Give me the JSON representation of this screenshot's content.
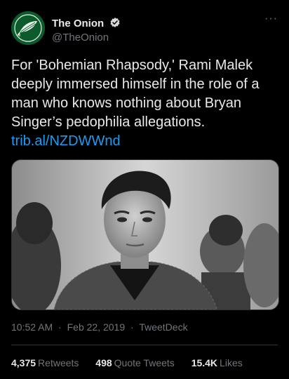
{
  "author": {
    "display_name": "The Onion",
    "handle": "@TheOnion",
    "verified": true,
    "avatar_icon": "onion-logo-icon",
    "avatar_color": "#0b5b2d"
  },
  "more_label": "···",
  "tweet": {
    "text": "For 'Bohemian Rhapsody,' Rami Malek deeply immersed himself in the role of a man who knows nothing about Bryan Singer’s pedophilia allegations.",
    "link_text": "trib.al/NZDWWnd",
    "link_color": "#1d9bf0"
  },
  "media": {
    "icon": "black-and-white-photo-portrait-icon"
  },
  "meta": {
    "time": "10:52 AM",
    "date": "Feb 22, 2019",
    "source": "TweetDeck",
    "separator": "·"
  },
  "stats": {
    "retweets_count": "4,375",
    "retweets_label": "Retweets",
    "quotes_count": "498",
    "quotes_label": "Quote Tweets",
    "likes_count": "15.4K",
    "likes_label": "Likes"
  },
  "colors": {
    "background": "#000000",
    "text_primary": "#e7e9ea",
    "text_secondary": "#71767b",
    "verified_badge": "#d9d9d9"
  }
}
